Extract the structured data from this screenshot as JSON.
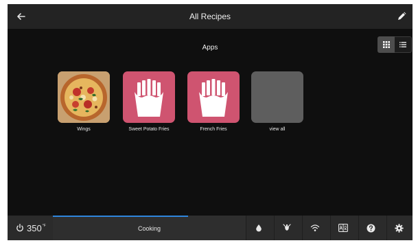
{
  "header": {
    "title": "All Recipes",
    "back_icon": "arrow-left-icon",
    "edit_icon": "pencil-icon"
  },
  "view_toggle": {
    "grid_icon": "grid-view-icon",
    "list_icon": "list-view-icon",
    "selected": "grid"
  },
  "section": {
    "title": "Apps"
  },
  "tiles": [
    {
      "label": "Wings",
      "icon": "pizza-photo"
    },
    {
      "label": "Sweet Potato Fries",
      "icon": "fries-icon"
    },
    {
      "label": "French Fries",
      "icon": "fries-icon"
    },
    {
      "label": "view all",
      "icon": ""
    }
  ],
  "footer": {
    "temperature": "350",
    "unit": "°F",
    "status_label": "Cooking",
    "progress_fraction": 0.7,
    "icons": [
      "water-drop-icon",
      "probe-icon",
      "wifi-icon",
      "language-icon",
      "help-icon",
      "settings-icon"
    ]
  },
  "colors": {
    "accent": "#2e86de",
    "tile_pink": "#cf5470",
    "tile_gray": "#5e5e5e",
    "background": "#0f0f0f"
  }
}
